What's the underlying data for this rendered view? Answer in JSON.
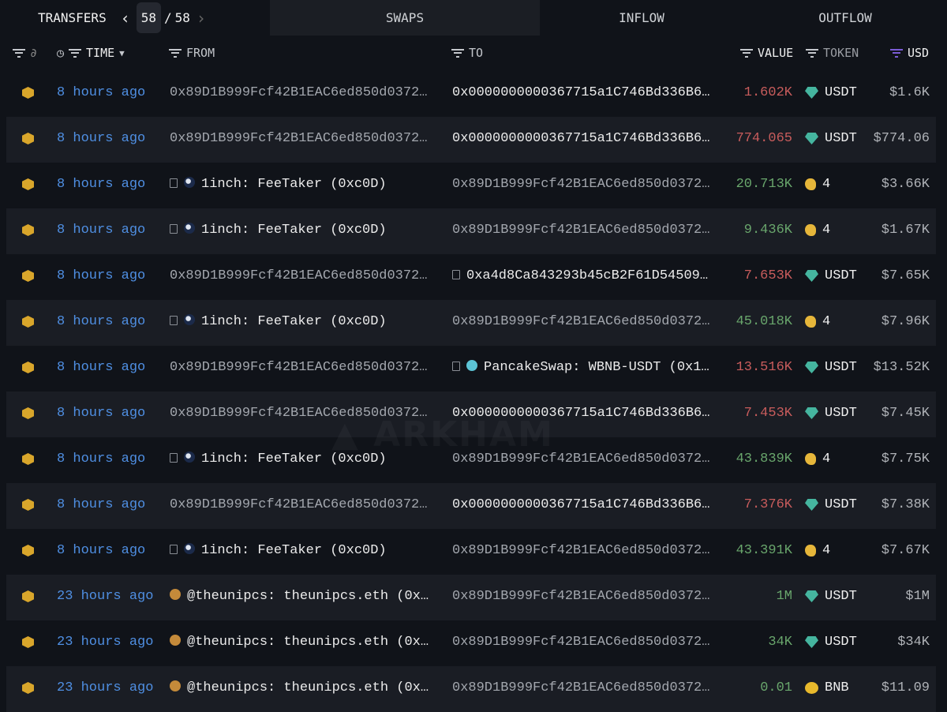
{
  "tabs": {
    "transfers": "TRANSFERS",
    "page_current": "58",
    "page_sep": "/",
    "page_total": "58",
    "swaps": "SWAPS",
    "inflow": "INFLOW",
    "outflow": "OUTFLOW"
  },
  "columns": {
    "time": "TIME",
    "from": "FROM",
    "to": "TO",
    "value": "VALUE",
    "token": "TOKEN",
    "usd": "USD"
  },
  "watermark": "ARKHAM",
  "rows": [
    {
      "time": "8 hours ago",
      "from": {
        "text": "0x89D1B999Fcf42B1EAC6ed850d0372…",
        "kind": "addr"
      },
      "to": {
        "text": "0x0000000000367715a1C746Bd336B6…",
        "kind": "plain"
      },
      "value": "1.602K",
      "dir": "neg",
      "token": "USDT",
      "token_icon": "usdt",
      "usd": "$1.6K"
    },
    {
      "time": "8 hours ago",
      "from": {
        "text": "0x89D1B999Fcf42B1EAC6ed850d0372…",
        "kind": "addr"
      },
      "to": {
        "text": "0x0000000000367715a1C746Bd336B6…",
        "kind": "plain"
      },
      "value": "774.065",
      "dir": "neg",
      "token": "USDT",
      "token_icon": "usdt",
      "usd": "$774.06"
    },
    {
      "time": "8 hours ago",
      "from": {
        "text": "1inch: FeeTaker (0xc0D)",
        "kind": "entity",
        "icon": "1inch"
      },
      "to": {
        "text": "0x89D1B999Fcf42B1EAC6ed850d0372…",
        "kind": "addr"
      },
      "value": "20.713K",
      "dir": "pos",
      "token": "4",
      "token_icon": "hand",
      "usd": "$3.66K"
    },
    {
      "time": "8 hours ago",
      "from": {
        "text": "1inch: FeeTaker (0xc0D)",
        "kind": "entity",
        "icon": "1inch"
      },
      "to": {
        "text": "0x89D1B999Fcf42B1EAC6ed850d0372…",
        "kind": "addr"
      },
      "value": "9.436K",
      "dir": "pos",
      "token": "4",
      "token_icon": "hand",
      "usd": "$1.67K"
    },
    {
      "time": "8 hours ago",
      "from": {
        "text": "0x89D1B999Fcf42B1EAC6ed850d0372…",
        "kind": "addr"
      },
      "to": {
        "text": "0xa4d8Ca843293b45cB2F61D54509…",
        "kind": "contract"
      },
      "value": "7.653K",
      "dir": "neg",
      "token": "USDT",
      "token_icon": "usdt",
      "usd": "$7.65K"
    },
    {
      "time": "8 hours ago",
      "from": {
        "text": "1inch: FeeTaker (0xc0D)",
        "kind": "entity",
        "icon": "1inch"
      },
      "to": {
        "text": "0x89D1B999Fcf42B1EAC6ed850d0372…",
        "kind": "addr"
      },
      "value": "45.018K",
      "dir": "pos",
      "token": "4",
      "token_icon": "hand",
      "usd": "$7.96K"
    },
    {
      "time": "8 hours ago",
      "from": {
        "text": "0x89D1B999Fcf42B1EAC6ed850d0372…",
        "kind": "addr"
      },
      "to": {
        "text": "PancakeSwap: WBNB-USDT (0x1…",
        "kind": "entity",
        "icon": "pancake"
      },
      "value": "13.516K",
      "dir": "neg",
      "token": "USDT",
      "token_icon": "usdt",
      "usd": "$13.52K"
    },
    {
      "time": "8 hours ago",
      "from": {
        "text": "0x89D1B999Fcf42B1EAC6ed850d0372…",
        "kind": "addr"
      },
      "to": {
        "text": "0x0000000000367715a1C746Bd336B6…",
        "kind": "plain"
      },
      "value": "7.453K",
      "dir": "neg",
      "token": "USDT",
      "token_icon": "usdt",
      "usd": "$7.45K"
    },
    {
      "time": "8 hours ago",
      "from": {
        "text": "1inch: FeeTaker (0xc0D)",
        "kind": "entity",
        "icon": "1inch"
      },
      "to": {
        "text": "0x89D1B999Fcf42B1EAC6ed850d0372…",
        "kind": "addr"
      },
      "value": "43.839K",
      "dir": "pos",
      "token": "4",
      "token_icon": "hand",
      "usd": "$7.75K"
    },
    {
      "time": "8 hours ago",
      "from": {
        "text": "0x89D1B999Fcf42B1EAC6ed850d0372…",
        "kind": "addr"
      },
      "to": {
        "text": "0x0000000000367715a1C746Bd336B6…",
        "kind": "plain"
      },
      "value": "7.376K",
      "dir": "neg",
      "token": "USDT",
      "token_icon": "usdt",
      "usd": "$7.38K"
    },
    {
      "time": "8 hours ago",
      "from": {
        "text": "1inch: FeeTaker (0xc0D)",
        "kind": "entity",
        "icon": "1inch"
      },
      "to": {
        "text": "0x89D1B999Fcf42B1EAC6ed850d0372…",
        "kind": "addr"
      },
      "value": "43.391K",
      "dir": "pos",
      "token": "4",
      "token_icon": "hand",
      "usd": "$7.67K"
    },
    {
      "time": "23 hours ago",
      "from": {
        "text": "@theunipcs: theunipcs.eth (0x…",
        "kind": "person",
        "icon": "avatar"
      },
      "to": {
        "text": "0x89D1B999Fcf42B1EAC6ed850d0372…",
        "kind": "addr"
      },
      "value": "1M",
      "dir": "pos",
      "token": "USDT",
      "token_icon": "usdt",
      "usd": "$1M"
    },
    {
      "time": "23 hours ago",
      "from": {
        "text": "@theunipcs: theunipcs.eth (0x…",
        "kind": "person",
        "icon": "avatar"
      },
      "to": {
        "text": "0x89D1B999Fcf42B1EAC6ed850d0372…",
        "kind": "addr"
      },
      "value": "34K",
      "dir": "pos",
      "token": "USDT",
      "token_icon": "usdt",
      "usd": "$34K"
    },
    {
      "time": "23 hours ago",
      "from": {
        "text": "@theunipcs: theunipcs.eth (0x…",
        "kind": "person",
        "icon": "avatar"
      },
      "to": {
        "text": "0x89D1B999Fcf42B1EAC6ed850d0372…",
        "kind": "addr"
      },
      "value": "0.01",
      "dir": "pos",
      "token": "BNB",
      "token_icon": "bnb",
      "usd": "$11.09"
    }
  ]
}
